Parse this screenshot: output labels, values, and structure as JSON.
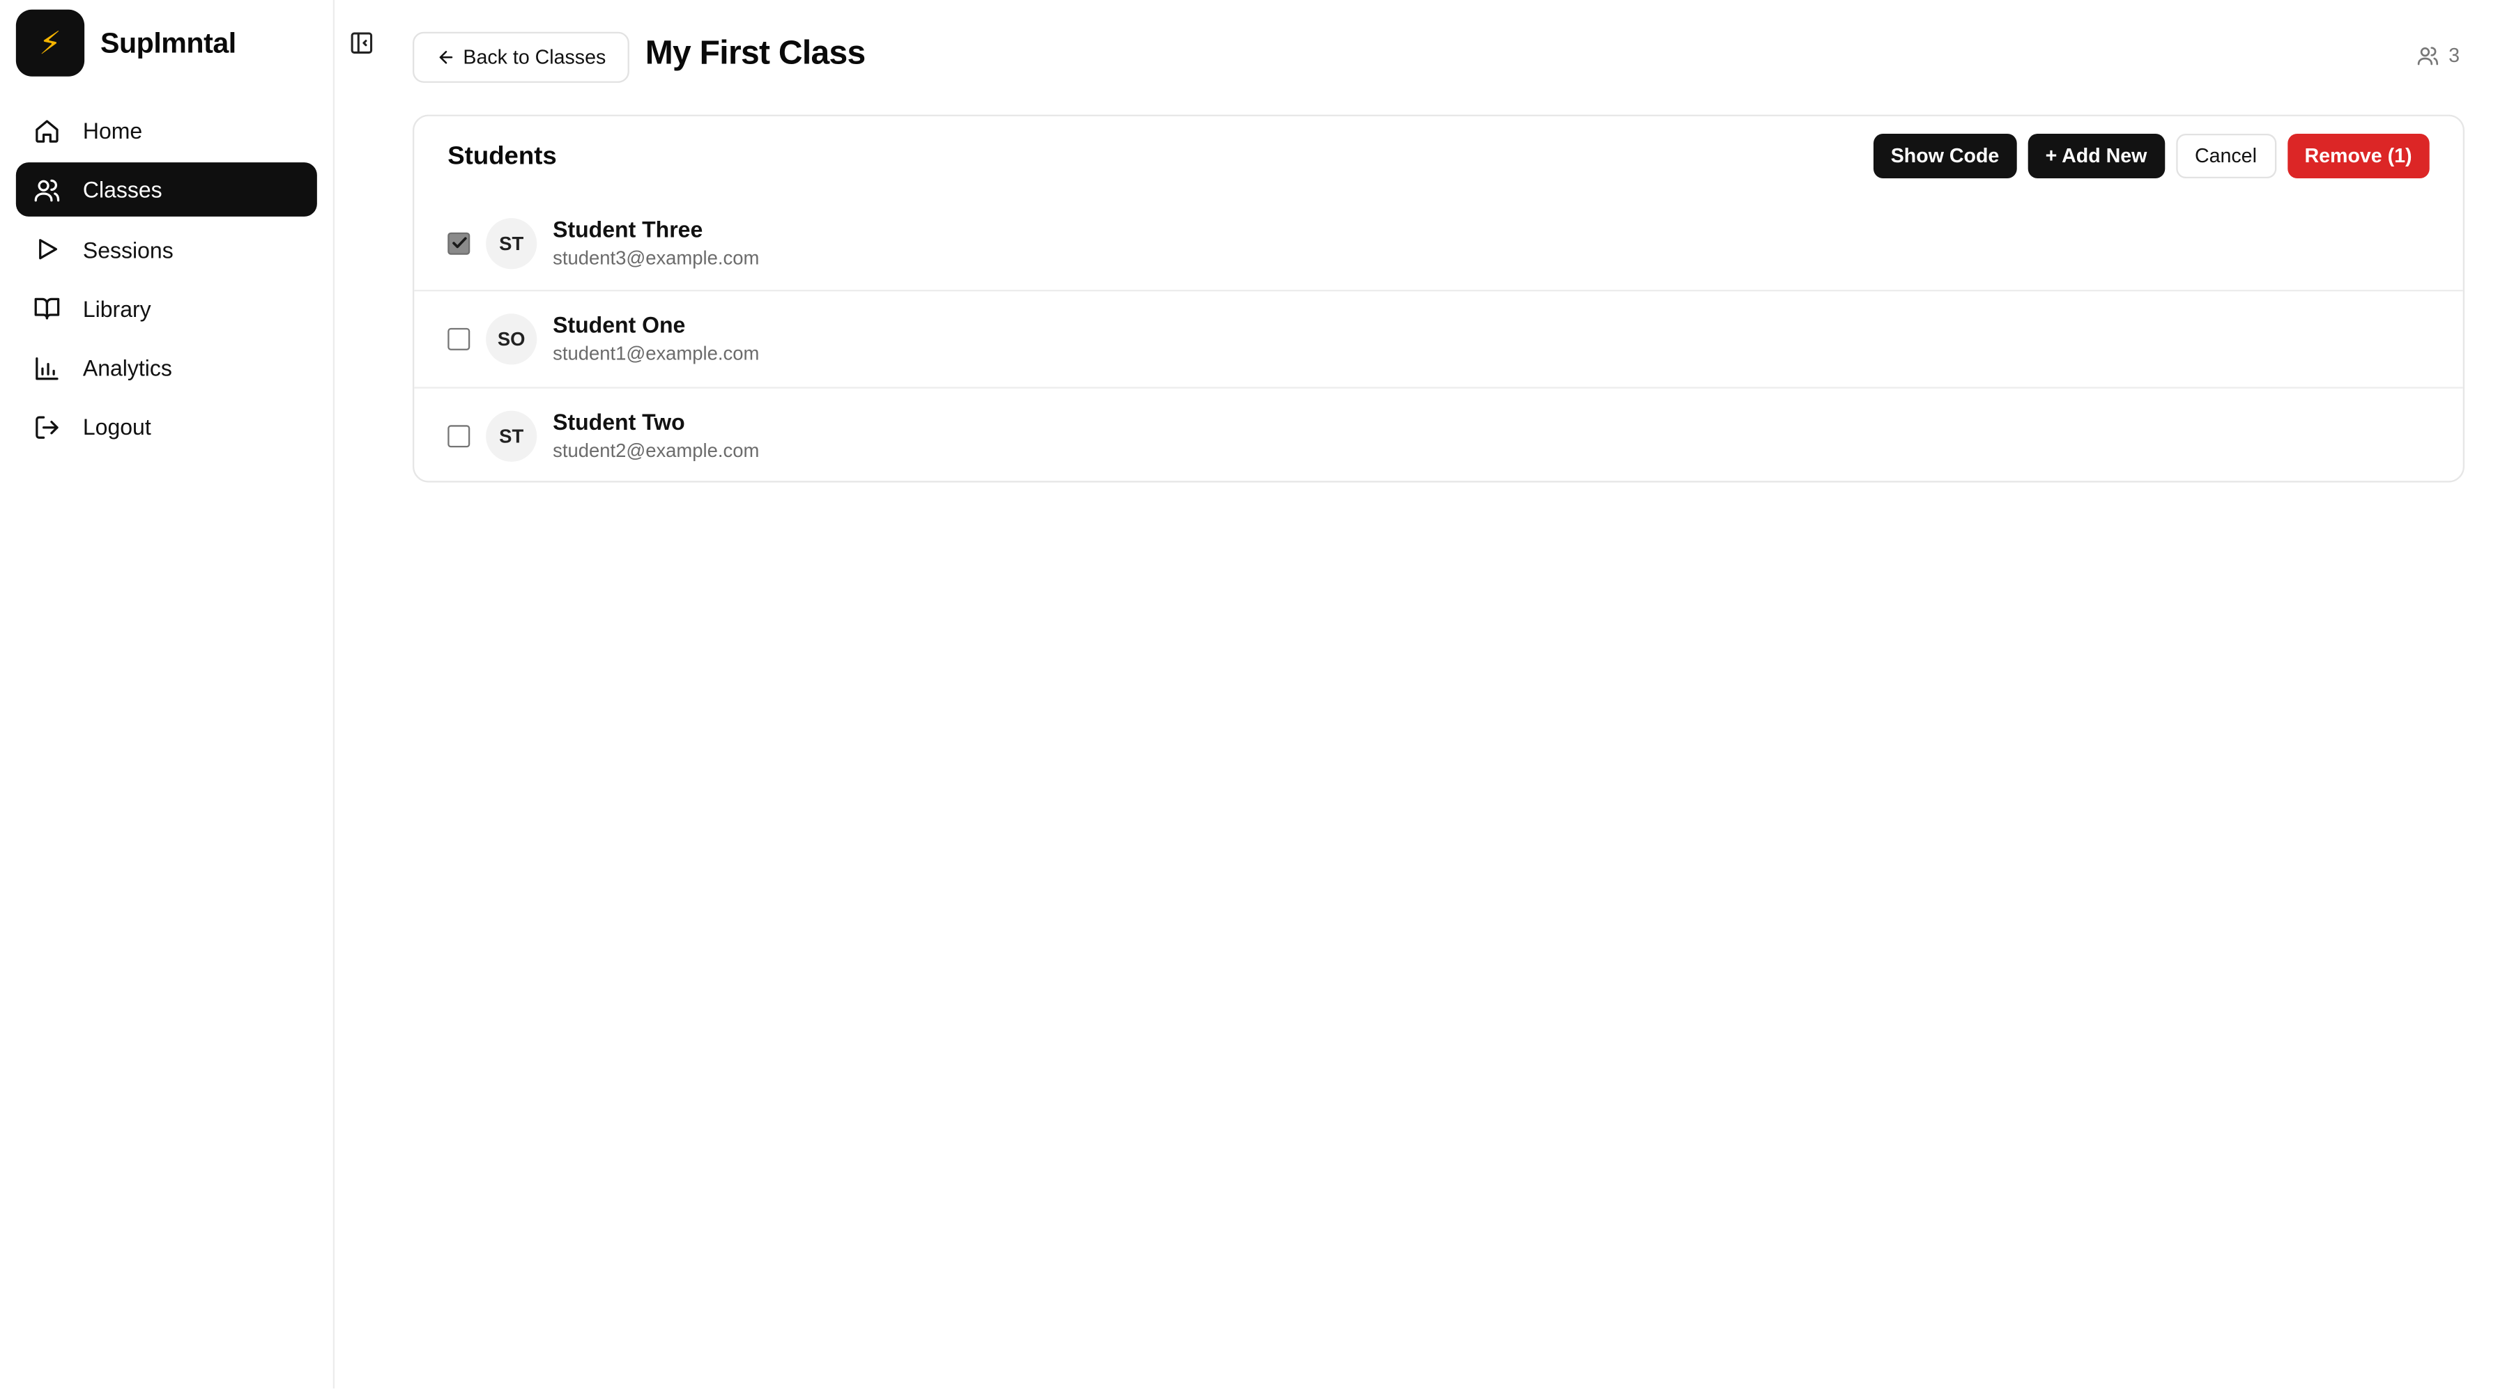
{
  "app": {
    "name": "Suplmntal",
    "logo_glyph": "⚡"
  },
  "sidebar": {
    "items": [
      {
        "label": "Home",
        "icon": "home-icon",
        "active": false
      },
      {
        "label": "Classes",
        "icon": "users-icon",
        "active": true
      },
      {
        "label": "Sessions",
        "icon": "play-icon",
        "active": false
      },
      {
        "label": "Library",
        "icon": "book-icon",
        "active": false
      },
      {
        "label": "Analytics",
        "icon": "bar-chart-icon",
        "active": false
      },
      {
        "label": "Logout",
        "icon": "logout-icon",
        "active": false
      }
    ]
  },
  "header": {
    "back_label": "Back to Classes",
    "title": "My First Class",
    "member_count": "3"
  },
  "students_card": {
    "title": "Students",
    "actions": {
      "show_code": "Show Code",
      "add_new": "+ Add New",
      "cancel": "Cancel",
      "remove": "Remove (1)"
    },
    "students": [
      {
        "initials": "ST",
        "name": "Student Three",
        "email": "student3@example.com",
        "checked": true
      },
      {
        "initials": "SO",
        "name": "Student One",
        "email": "student1@example.com",
        "checked": false
      },
      {
        "initials": "ST",
        "name": "Student Two",
        "email": "student2@example.com",
        "checked": false
      }
    ]
  },
  "colors": {
    "primary_dark": "#121212",
    "danger": "#dc2626",
    "logo_bolt": "#f5b400"
  }
}
